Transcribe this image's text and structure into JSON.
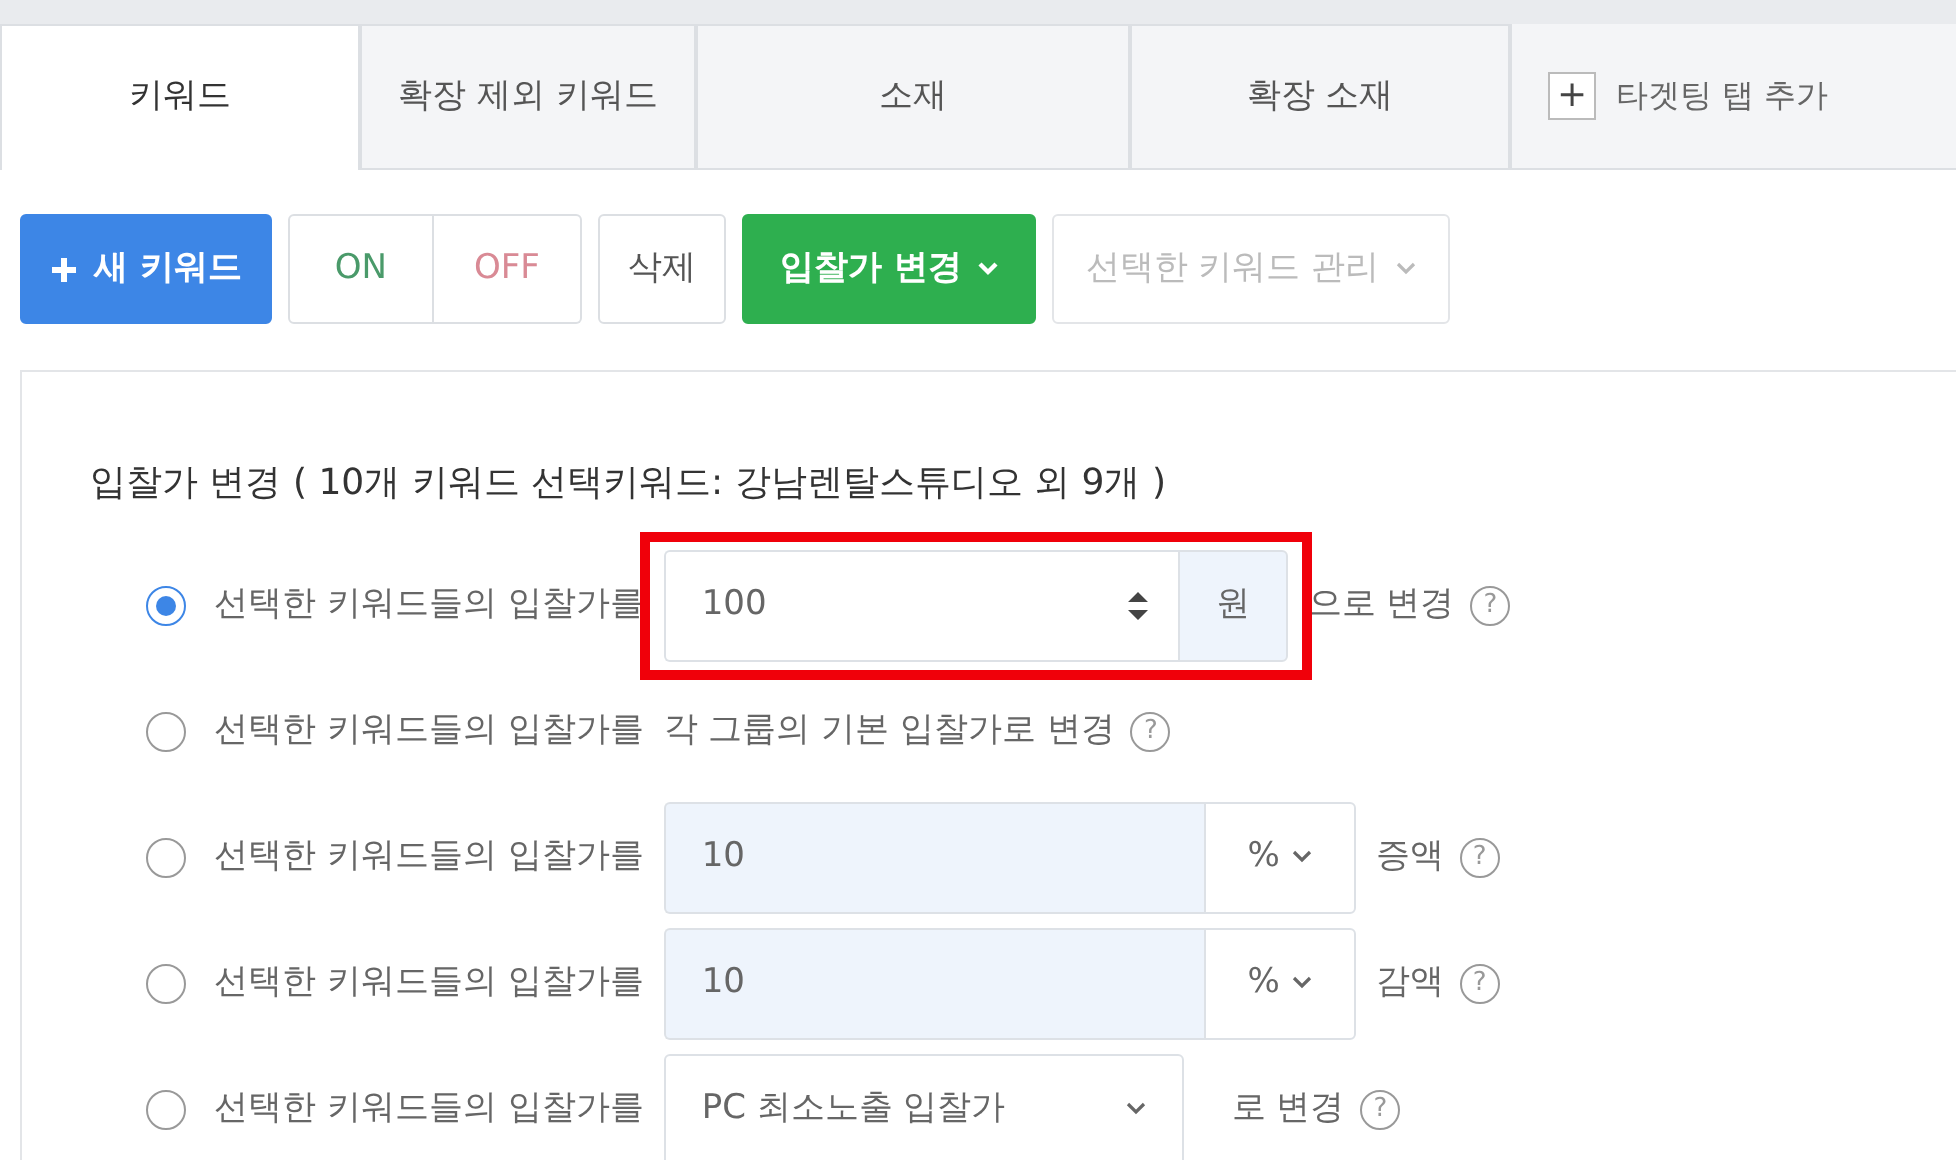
{
  "tabs": [
    {
      "label": "키워드",
      "selected": true
    },
    {
      "label": "확장 제외 키워드",
      "selected": false
    },
    {
      "label": "소재",
      "selected": false
    },
    {
      "label": "확장 소재",
      "selected": false
    }
  ],
  "add_tab": {
    "icon": "+",
    "label": "타겟팅 탭 추가"
  },
  "toolbar": {
    "new_keyword": "새 키워드",
    "on": "ON",
    "off": "OFF",
    "delete": "삭제",
    "bid_change": "입찰가 변경",
    "manage": {
      "label": "선택한 키워드 관리",
      "disabled": true
    }
  },
  "panel": {
    "heading": "입찰가 변경 ( 10개 키워드 선택키워드: 강남렌탈스튜디오 외 9개 )",
    "options": [
      {
        "kind": "amount",
        "selected": true,
        "highlighted": true,
        "label": "선택한 키워드들의 입찰가를",
        "value": "100",
        "unit": "원",
        "suffix": "으로 변경",
        "help": "?"
      },
      {
        "kind": "text",
        "selected": false,
        "highlighted": false,
        "label": "선택한 키워드들의 입찰가를",
        "suffix": "각 그룹의 기본 입찰가로 변경",
        "help": "?"
      },
      {
        "kind": "percent",
        "selected": false,
        "highlighted": false,
        "label": "선택한 키워드들의 입찰가를",
        "value": "10",
        "unit": "%",
        "suffix": "증액",
        "help": "?"
      },
      {
        "kind": "percent",
        "selected": false,
        "highlighted": false,
        "label": "선택한 키워드들의 입찰가를",
        "value": "10",
        "unit": "%",
        "suffix": "감액",
        "help": "?"
      },
      {
        "kind": "select",
        "selected": false,
        "highlighted": false,
        "label": "선택한 키워드들의 입찰가를",
        "value": "PC 최소노출 입찰가",
        "suffix": "로 변경",
        "help": "?"
      }
    ]
  }
}
